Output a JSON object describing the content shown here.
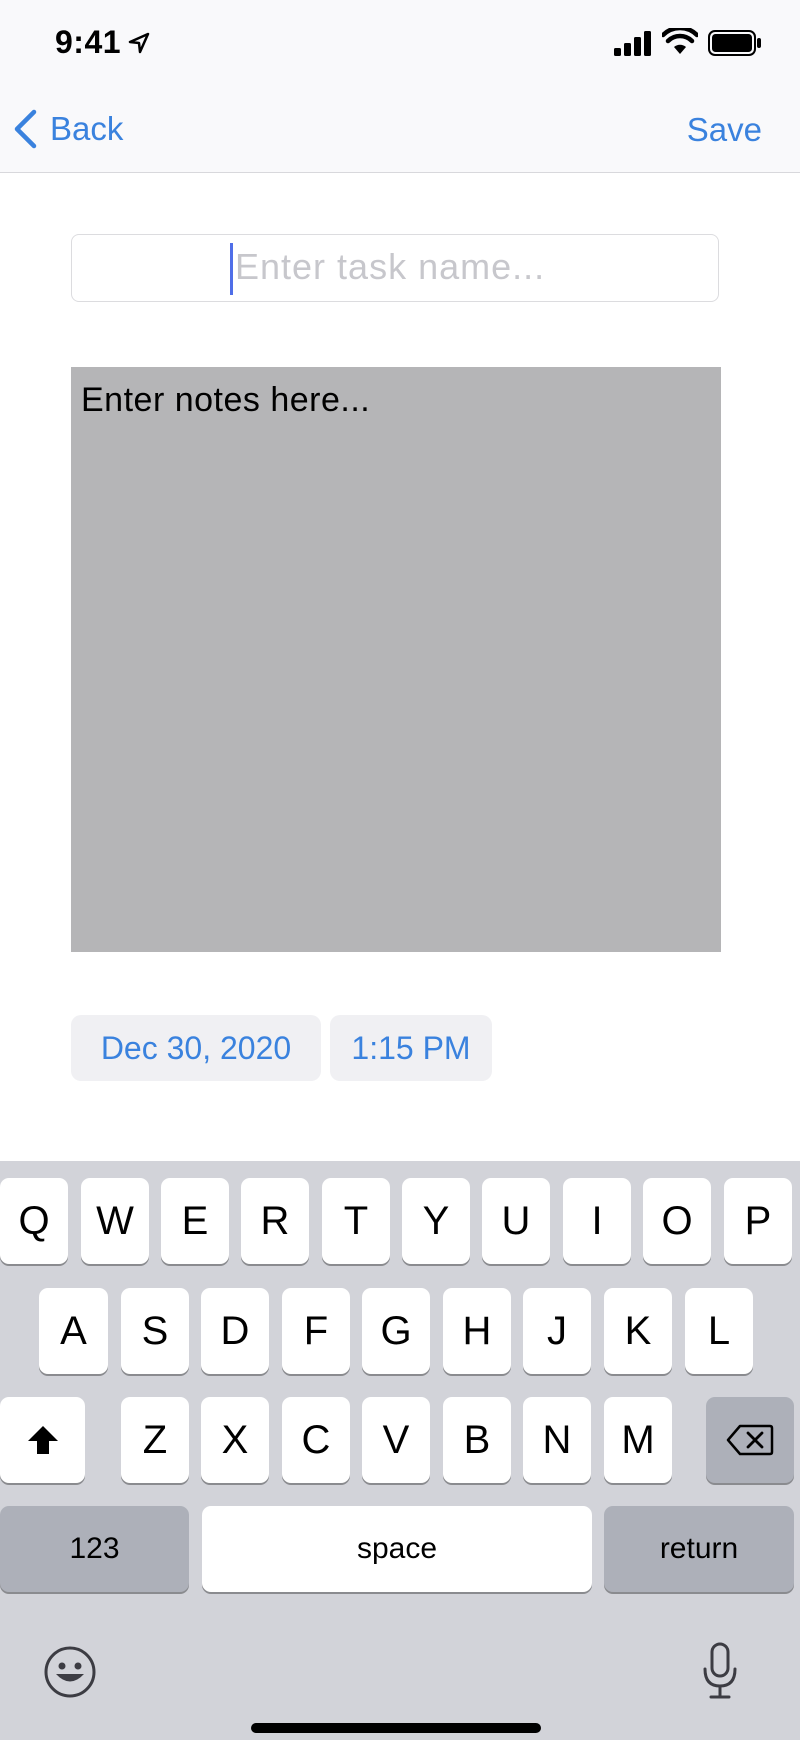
{
  "status_bar": {
    "time": "9:41"
  },
  "nav": {
    "back_label": "Back",
    "save_label": "Save"
  },
  "form": {
    "task_placeholder": "Enter task name...",
    "notes_text": "Enter notes here...",
    "date": "Dec 30, 2020",
    "time": "1:15 PM"
  },
  "keyboard": {
    "row1": [
      "Q",
      "W",
      "E",
      "R",
      "T",
      "Y",
      "U",
      "I",
      "O",
      "P"
    ],
    "row2": [
      "A",
      "S",
      "D",
      "F",
      "G",
      "H",
      "J",
      "K",
      "L"
    ],
    "row3": [
      "Z",
      "X",
      "C",
      "V",
      "B",
      "N",
      "M"
    ],
    "numbers_label": "123",
    "space_label": "space",
    "return_label": "return"
  },
  "colors": {
    "accent": "#3a82de",
    "notes_background": "#b5b5b7",
    "keyboard_background": "#d2d3d9",
    "cursor": "#4f6ee8"
  }
}
